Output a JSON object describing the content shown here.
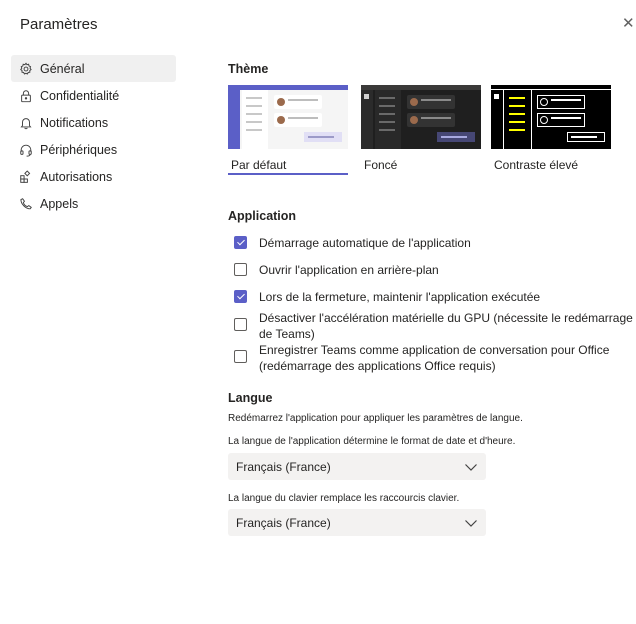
{
  "window": {
    "title": "Paramètres",
    "close_glyph": "✕"
  },
  "sidebar": {
    "items": [
      {
        "label": "Général",
        "icon": "gear-icon",
        "active": true
      },
      {
        "label": "Confidentialité",
        "icon": "lock-icon"
      },
      {
        "label": "Notifications",
        "icon": "bell-icon"
      },
      {
        "label": "Périphériques",
        "icon": "headset-icon"
      },
      {
        "label": "Autorisations",
        "icon": "grid-icon"
      },
      {
        "label": "Appels",
        "icon": "phone-icon"
      }
    ]
  },
  "theme": {
    "title": "Thème",
    "options": [
      {
        "label": "Par défaut",
        "selected": true
      },
      {
        "label": "Foncé"
      },
      {
        "label": "Contraste élevé"
      }
    ]
  },
  "application": {
    "title": "Application",
    "options": [
      {
        "label": "Démarrage automatique de l'application",
        "checked": true
      },
      {
        "label": "Ouvrir l'application en arrière-plan",
        "checked": false
      },
      {
        "label": "Lors de la fermeture, maintenir l'application exécutée",
        "checked": true
      },
      {
        "label": "Désactiver l'accélération matérielle du GPU (nécessite le redémarrage de Teams)",
        "checked": false
      },
      {
        "label": "Enregistrer Teams comme application de conversation pour Office (redémarrage des applications Office requis)",
        "checked": false
      }
    ]
  },
  "language": {
    "title": "Langue",
    "restart_note": "Redémarrez l'application pour appliquer les paramètres de langue.",
    "app_lang_note": "La langue de l'application détermine le format de date et d'heure.",
    "app_lang_value": "Français (France)",
    "keyboard_note": "La langue du clavier remplace les raccourcis clavier.",
    "keyboard_value": "Français (France)"
  },
  "colors": {
    "accent": "#5b5fc7",
    "nav_active_bg": "#f0f0f0",
    "select_bg": "#f3f2f1"
  }
}
